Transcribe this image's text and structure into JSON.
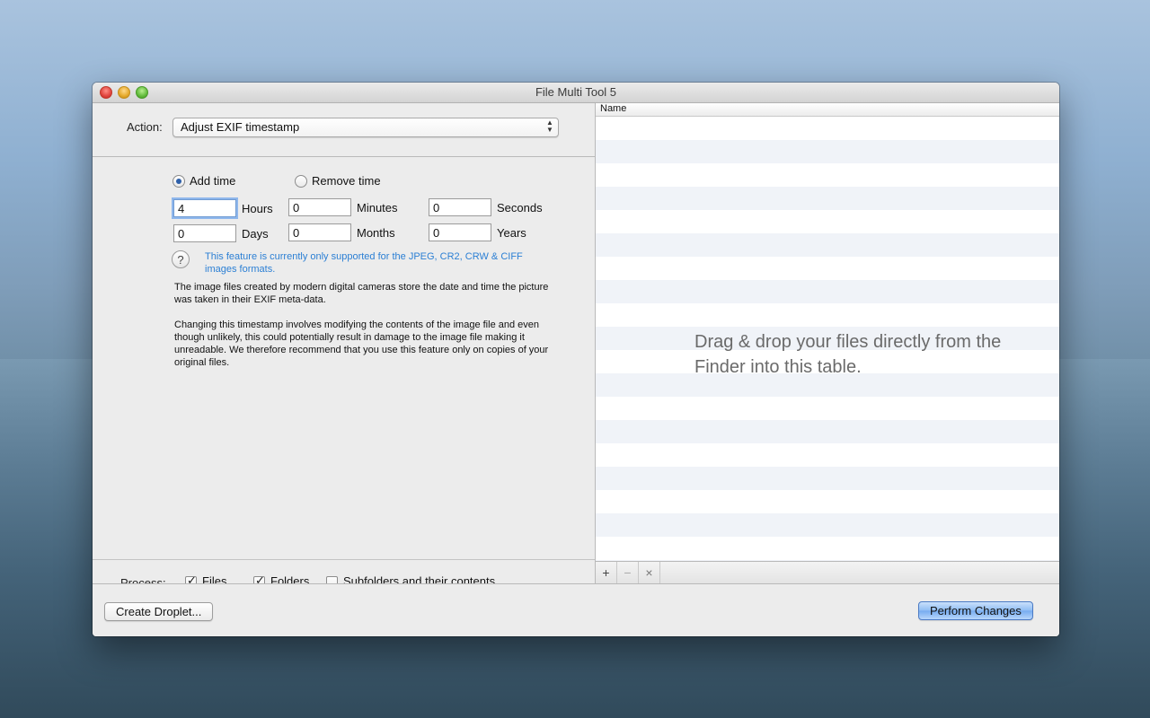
{
  "window": {
    "title": "File Multi Tool 5"
  },
  "action": {
    "label": "Action:",
    "selected": "Adjust EXIF timestamp"
  },
  "time_mode": {
    "add_label": "Add time",
    "remove_label": "Remove time",
    "selected": "add"
  },
  "fields": {
    "hours": {
      "value": "4",
      "unit": "Hours"
    },
    "minutes": {
      "value": "0",
      "unit": "Minutes"
    },
    "seconds": {
      "value": "0",
      "unit": "Seconds"
    },
    "days": {
      "value": "0",
      "unit": "Days"
    },
    "months": {
      "value": "0",
      "unit": "Months"
    },
    "years": {
      "value": "0",
      "unit": "Years"
    }
  },
  "help": {
    "symbol": "?"
  },
  "notice": "This feature is currently only supported for the JPEG, CR2, CRW & CIFF images formats.",
  "description": [
    "The image files created by modern digital cameras store the date and time the picture was taken in their EXIF meta-data.",
    "Changing this timestamp involves modifying the contents of the image file and even though unlikely, this could potentially result in damage to the image file making it unreadable. We therefore recommend that you use this feature only on copies of your original files."
  ],
  "process": {
    "label": "Process:",
    "files": {
      "label": "Files",
      "checked": true
    },
    "folders": {
      "label": "Folders",
      "checked": true
    },
    "subfolders": {
      "label": "Subfolders and their contents",
      "checked": false
    }
  },
  "table": {
    "column_name": "Name",
    "drop_hint": "Drag & drop your files directly from the Finder into this table.",
    "footer": {
      "add": "+",
      "remove": "−",
      "clear": "×"
    }
  },
  "buttons": {
    "create_droplet": "Create Droplet...",
    "perform_changes": "Perform Changes"
  },
  "colors": {
    "accent_blue": "#2b7fd4",
    "row_stripe": "#f0f3f8"
  },
  "icons": {
    "popup_arrows": "updown-arrows-icon",
    "help": "question-icon"
  }
}
